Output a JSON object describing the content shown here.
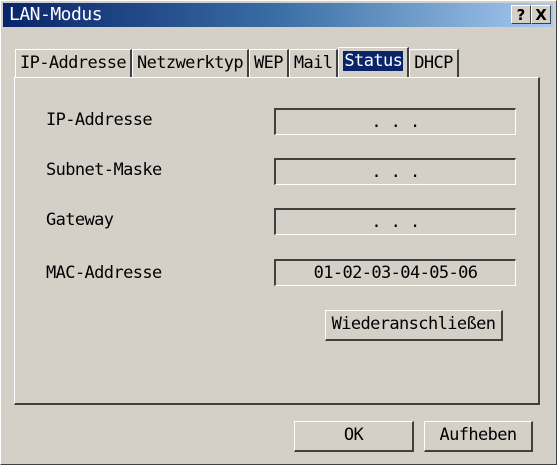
{
  "window": {
    "title": "LAN-Modus",
    "help_label": "?",
    "close_label": "X"
  },
  "tabs": [
    {
      "label": "IP-Addresse",
      "active": false
    },
    {
      "label": "Netzwerktyp",
      "active": false
    },
    {
      "label": "WEP",
      "active": false
    },
    {
      "label": "Mail",
      "active": false
    },
    {
      "label": "Status",
      "active": true
    },
    {
      "label": "DHCP",
      "active": false
    }
  ],
  "status": {
    "rows": [
      {
        "label": "IP-Addresse",
        "value": ".   .   ."
      },
      {
        "label": "Subnet-Maske",
        "value": ".   .   ."
      },
      {
        "label": "Gateway",
        "value": ".   .   ."
      },
      {
        "label": "MAC-Addresse",
        "value": "01-02-03-04-05-06"
      }
    ],
    "reconnect_label": "Wiederanschließen"
  },
  "footer": {
    "ok_label": "OK",
    "cancel_label": "Aufheben"
  },
  "colors": {
    "face": "#d4d0c8",
    "title_start": "#0a246a",
    "title_end": "#a6caf0",
    "highlight": "#0a246a"
  }
}
